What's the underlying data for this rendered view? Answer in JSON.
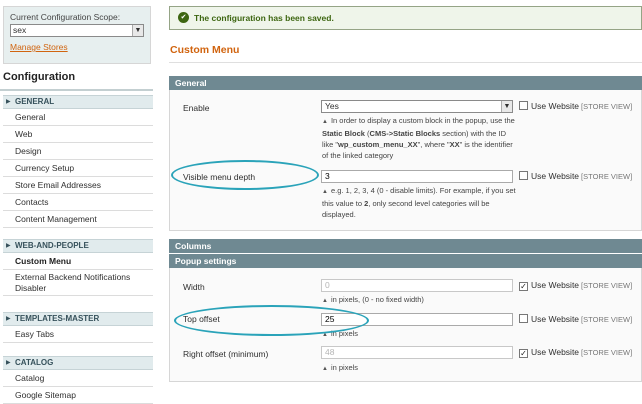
{
  "sidebar": {
    "scope_label": "Current Configuration Scope:",
    "scope_value": "sex",
    "manage_stores": "Manage Stores",
    "title": "Configuration",
    "groups": [
      {
        "title": "GENERAL",
        "items": [
          "General",
          "Web",
          "Design",
          "Currency Setup",
          "Store Email Addresses",
          "Contacts",
          "Content Management"
        ]
      },
      {
        "title": "WEB-AND-PEOPLE",
        "items": [
          "Custom Menu",
          "External Backend Notifications Disabler"
        ]
      },
      {
        "title": "TEMPLATES-MASTER",
        "items": [
          "Easy Tabs"
        ]
      },
      {
        "title": "CATALOG",
        "items": [
          "Catalog",
          "Google Sitemap"
        ]
      }
    ]
  },
  "message": {
    "text": "The configuration has been saved."
  },
  "page_title": "Custom Menu",
  "sections": {
    "general": "General",
    "columns": "Columns",
    "popup": "Popup settings"
  },
  "fields": {
    "enable": {
      "label": "Enable",
      "value": "Yes",
      "note_pre": "In order to display a custom block in the popup, use the ",
      "note_b1": "Static Block",
      "note_mid1": " (",
      "note_b2": "CMS->Static Blocks",
      "note_mid2": " section) with the ID like \"",
      "note_b3": "wp_custom_menu_XX",
      "note_mid3": "\", where \"",
      "note_b4": "XX",
      "note_post": "\" is the identifier of the linked category"
    },
    "depth": {
      "label": "Visible menu depth",
      "value": "3",
      "note_pre": "e.g. 1, 2, 3, 4 (0 - disable limits). For example, if you set this value to ",
      "note_b": "2",
      "note_post": ", only second level categories will be displayed."
    },
    "width": {
      "label": "Width",
      "value": "0",
      "note": "in pixels, (0 - no fixed width)"
    },
    "top_offset": {
      "label": "Top offset",
      "value": "25",
      "note": "in pixels"
    },
    "right_offset": {
      "label": "Right offset (minimum)",
      "value": "48",
      "note": "in pixels"
    }
  },
  "use_website": {
    "label": "Use Website",
    "store_view": "[STORE VIEW]"
  },
  "icons": {
    "check": "✓",
    "arrow": "▼",
    "triangle_right": "▶",
    "triangle_up": "▲",
    "check_circle": "✔"
  },
  "colors": {
    "accent": "#d1640f",
    "section_header": "#6f8992",
    "highlight_oval": "#2aa3b9",
    "success": "#3d6611"
  }
}
